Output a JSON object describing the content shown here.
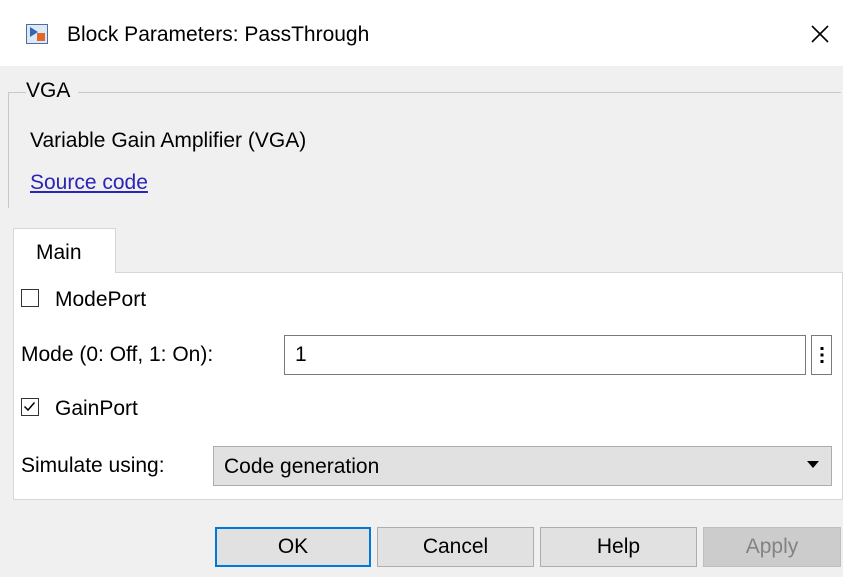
{
  "window": {
    "title": "Block Parameters: PassThrough",
    "close_glyph": "✕",
    "icon": "simulink-block-icon"
  },
  "description": {
    "group_title": "VGA",
    "text": "Variable Gain Amplifier (VGA)",
    "link": "Source code"
  },
  "tabs": [
    {
      "label": "Main",
      "selected": true
    }
  ],
  "parameters": {
    "mode_port": {
      "label": "ModePort",
      "checked": false
    },
    "mode": {
      "label": "Mode (0: Off, 1: On):",
      "value": "1"
    },
    "gain_port": {
      "label": "GainPort",
      "checked": true
    },
    "simulate_using": {
      "label": "Simulate using:",
      "value": "Code generation"
    }
  },
  "buttons": {
    "ok": "OK",
    "cancel": "Cancel",
    "help": "Help",
    "apply": "Apply"
  },
  "colors": {
    "link": "#2a24b8",
    "default_button_border": "#0078d7",
    "disabled_text": "#838383"
  }
}
